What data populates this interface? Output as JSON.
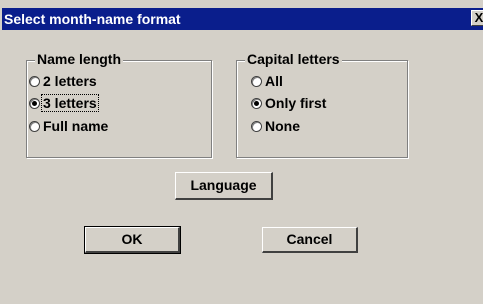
{
  "dialog": {
    "title": "Select month-name format",
    "close_label": "X"
  },
  "name_length": {
    "label": "Name length",
    "options": [
      {
        "label": "2 letters",
        "checked": false
      },
      {
        "label": "3 letters",
        "checked": true
      },
      {
        "label": "Full name",
        "checked": false
      }
    ]
  },
  "capital_letters": {
    "label": "Capital letters",
    "options": [
      {
        "label": "All",
        "checked": false
      },
      {
        "label": "Only first",
        "checked": true
      },
      {
        "label": "None",
        "checked": false
      }
    ]
  },
  "buttons": {
    "language": "Language",
    "ok": "OK",
    "cancel": "Cancel"
  },
  "colors": {
    "titlebar": "#0a1e8c",
    "face": "#d4d0c8"
  }
}
